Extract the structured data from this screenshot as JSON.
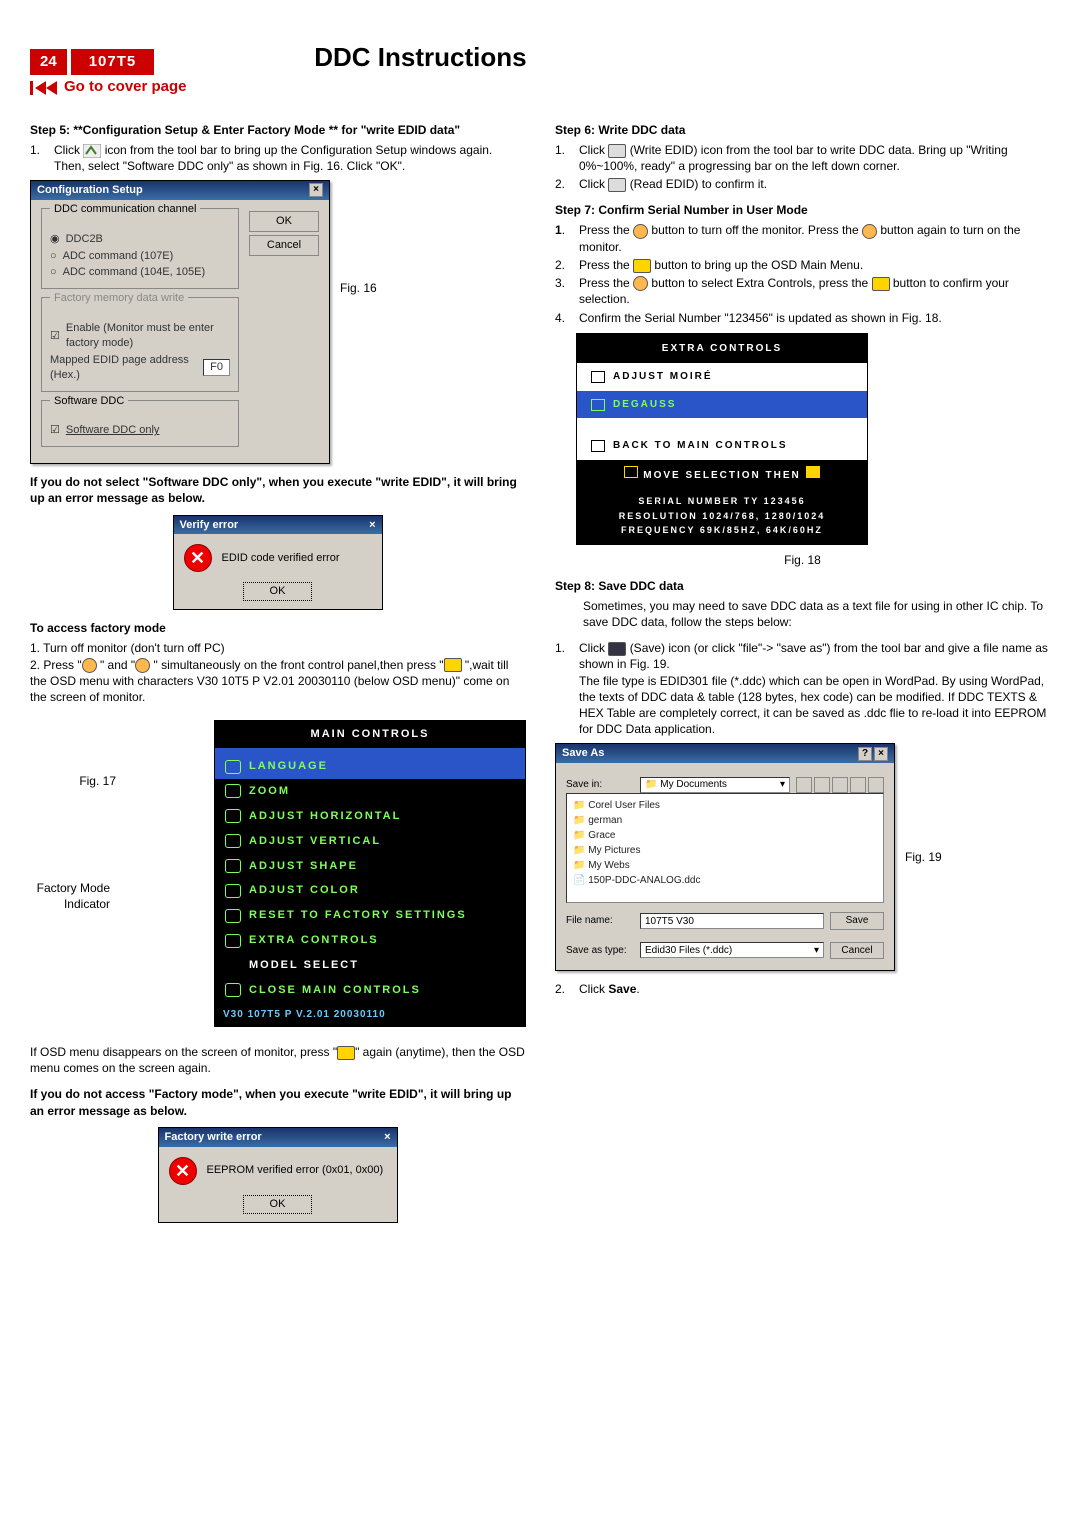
{
  "header": {
    "page_number": "24",
    "model": "107T5",
    "title": "DDC Instructions",
    "cover_link": "Go to cover page"
  },
  "left": {
    "step5_title": "Step 5: **Configuration Setup & Enter Factory Mode ** for \"write EDID data\"",
    "step5_item1": "Click",
    "step5_item1_cont": "icon from the tool bar to bring up the Configuration Setup windows again. Then, select \"Software DDC only\" as shown in Fig. 16. Click \"OK\".",
    "fig16": "Fig. 16",
    "config": {
      "title": "Configuration Setup",
      "group1": "DDC communication channel",
      "r1": "DDC2B",
      "r2": "ADC command (107E)",
      "r3": "ADC command (104E, 105E)",
      "group2": "Factory memory data write",
      "c1": "Enable (Monitor must be enter factory mode)",
      "maplbl": "Mapped EDID page address (Hex.)",
      "mapval": "F0",
      "group3": "Software DDC",
      "c2": "Software DDC only",
      "ok": "OK",
      "cancel": "Cancel"
    },
    "warn1": "If you do not select \"Software DDC only\", when you execute \"write EDID\", it will bring up an error message as below.",
    "err1_title": "Verify error",
    "err1_msg": "EDID code verified error",
    "err1_ok": "OK",
    "access_title": "To access factory mode",
    "a1": "1. Turn off monitor (don't turn off PC)",
    "a2a": "2. Press \"",
    "a2b": "\" and \"",
    "a2c": "\" simultaneously on the front control panel,then press \"",
    "a2d": "\",wait till the OSD menu with characters V30 10T5 P V2.01  20030110 (below OSD menu)\" come on the screen of monitor.",
    "fig17": "Fig. 17",
    "fm_label1": "Factory Mode",
    "fm_label2": "Indicator",
    "osd": {
      "hdr": "MAIN  CONTROLS",
      "lang": "LANGUAGE",
      "items": [
        "ZOOM",
        "ADJUST  HORIZONTAL",
        "ADJUST  VERTICAL",
        "ADJUST  SHAPE",
        "ADJUST  COLOR",
        "RESET  TO  FACTORY  SETTINGS",
        "EXTRA  CONTROLS"
      ],
      "model_select": "MODEL  SELECT",
      "close": "CLOSE  MAIN  CONTROLS",
      "foot": "V30  107T5  P  V.2.01   20030110"
    },
    "post_osd": "If OSD menu disappears on the screen of monitor, press \"",
    "post_osd2": "\" again (anytime), then the OSD menu comes on the screen again.",
    "warn2": "If you do not access \"Factory mode\", when you execute \"write EDID\", it will bring up an error message as below.",
    "err2_title": "Factory write error",
    "err2_msg": "EEPROM verified error (0x01, 0x00)",
    "err2_ok": "OK"
  },
  "right": {
    "step6_title": "Step 6: Write DDC data",
    "s6_1a": "Click",
    "s6_1b": "(Write EDID) icon from the tool bar to write DDC data. Bring up \"Writing 0%~100%, ready\" a progressing bar on the left down corner.",
    "s6_2a": "Click",
    "s6_2b": "(Read EDID) to confirm it.",
    "step7_title": "Step 7: Confirm Serial Number in User Mode",
    "s7_1a": "Press the",
    "s7_1b": "button to turn off the monitor. Press the",
    "s7_1c": "button again to turn on the monitor.",
    "s7_2a": "Press the",
    "s7_2b": "button to bring up the OSD Main Menu.",
    "s7_3a": "Press the",
    "s7_3b": "button to select Extra Controls, press the",
    "s7_3c": "button to confirm your selection.",
    "s7_4": "Confirm the Serial Number \"123456\" is updated as shown in Fig. 18.",
    "osd2": {
      "hdr": "EXTRA  CONTROLS",
      "row1": "ADJUST  MOIRÉ",
      "row2": "DEGAUSS",
      "row3": "BACK  TO  MAIN  CONTROLS",
      "move": "MOVE  SELECTION  THEN",
      "foot1": "SERIAL  NUMBER  TY  123456",
      "foot2": "RESOLUTION  1024/768,  1280/1024",
      "foot3": "FREQUENCY  69K/85HZ,  64K/60HZ"
    },
    "fig18": "Fig. 18",
    "step8_title": "Step 8: Save DDC data",
    "s8_intro": "Sometimes, you may need to save DDC data as a text file for using in other IC chip. To save DDC data, follow the steps below:",
    "s8_1a": "Click",
    "s8_1b": "(Save) icon (or click \"file\"-> \"save as\") from the tool bar and give a file name as shown in Fig. 19.",
    "s8_1c": "The file type is EDID301 file (*.ddc) which can be open in WordPad. By using WordPad, the texts of DDC data & table (128 bytes, hex code) can be modified. If DDC TEXTS & HEX Table are completely correct, it can be saved as .ddc flie to re-load it into EEPROM for DDC Data application.",
    "fig19": "Fig. 19",
    "save": {
      "title": "Save As",
      "savein_lbl": "Save in:",
      "savein_val": "My Documents",
      "files": [
        "Corel User Files",
        "german",
        "Grace",
        "My Pictures",
        "My Webs",
        "150P-DDC-ANALOG.ddc"
      ],
      "fname_lbl": "File name:",
      "fname_val": "107T5 V30",
      "ftype_lbl": "Save as type:",
      "ftype_val": "Edid30 Files (*.ddc)",
      "save_btn": "Save",
      "cancel_btn": "Cancel"
    },
    "s8_2": "Click Save."
  }
}
